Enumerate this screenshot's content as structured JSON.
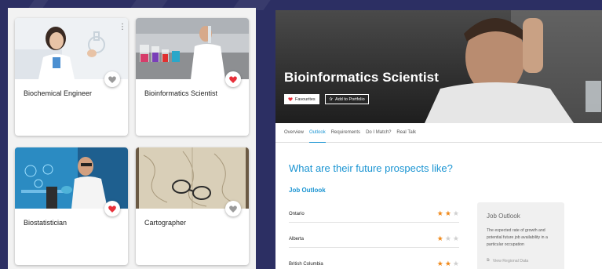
{
  "cards": [
    {
      "title": "Biochemical Engineer",
      "favorited": false,
      "icon": "heart-outline-icon"
    },
    {
      "title": "Bioinformatics Scientist",
      "favorited": true,
      "icon": "heart-filled-icon"
    },
    {
      "title": "Biostatistician",
      "favorited": true,
      "icon": "heart-filled-icon"
    },
    {
      "title": "Cartographer",
      "favorited": false,
      "icon": "heart-outline-icon"
    }
  ],
  "career": {
    "title": "Bioinformatics Scientist",
    "favourites_label": "Favourites",
    "add_portfolio_label": "Add to Portfolio"
  },
  "tabs": [
    "Overview",
    "Outlook",
    "Requirements",
    "Do I Match?",
    "Real Talk"
  ],
  "active_tab": "Outlook",
  "outlook": {
    "heading": "What are their future prospects like?",
    "subheading": "Job Outlook",
    "rows": [
      {
        "region": "Ontario",
        "stars": 2,
        "max": 3
      },
      {
        "region": "Alberta",
        "stars": 1,
        "max": 3
      },
      {
        "region": "British Columbia",
        "stars": 2,
        "max": 3
      }
    ]
  },
  "sidebox": {
    "title": "Job Outlook",
    "description": "The expected rate of growth and potential future job availability in a particular occupation",
    "link": "View Regional Data"
  },
  "colors": {
    "background": "#2c2f63",
    "accent": "#1a94d2",
    "heart": "#e8303a",
    "star": "#f08a1c"
  }
}
